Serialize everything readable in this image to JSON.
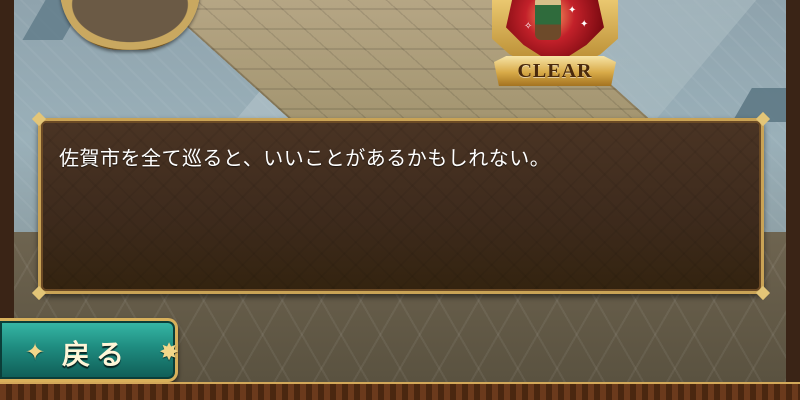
{
  "badge": {
    "text": "CLEAR"
  },
  "dialog": {
    "message": "佐賀市を全て巡ると、いいことがあるかもしれない。"
  },
  "back_button": {
    "label": "戻る",
    "left_icon": "compass-ornament-icon",
    "right_icon": "compass-ornament-icon"
  }
}
